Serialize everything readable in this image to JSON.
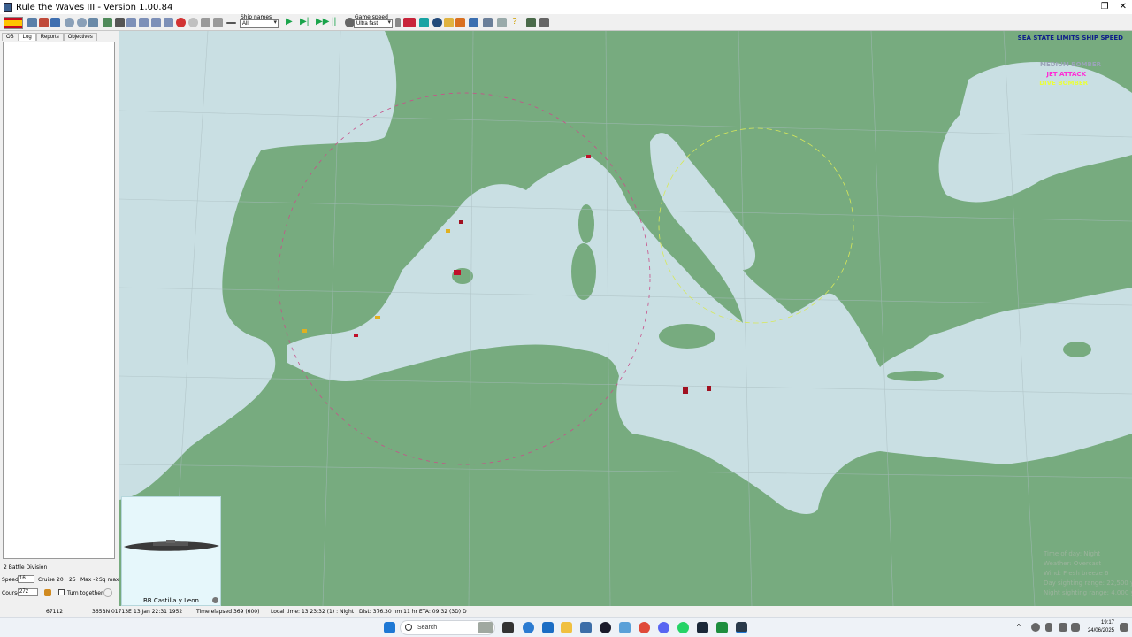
{
  "window": {
    "title": "Rule the Waves III - Version 1.00.84",
    "minimize": "─",
    "close": "✕",
    "restore": "❐"
  },
  "toolbar": {
    "ship_names_label": "Ship names",
    "ship_names_value": "All",
    "game_speed_label": "Game speed",
    "game_speed_value": "Ultra fast",
    "flag_country": "Spain"
  },
  "left_panel": {
    "tabs": [
      "OB",
      "Log",
      "Reports",
      "Objectives"
    ],
    "division_name": "2 Battle Division",
    "speed_label": "Speed",
    "speed_value": "16",
    "cruise_label": "Cruise",
    "cruise_values": [
      "20",
      "25"
    ],
    "max_label": "Max -2",
    "sq_label": "Sq max",
    "course_label": "Course",
    "course_value": "272",
    "turn_together_label": "Turn together"
  },
  "ship_card": {
    "name": "BB Castilla y Leon"
  },
  "map": {
    "sea_state_notice": "SEA STATE LIMITS SHIP SPEED",
    "legend": [
      {
        "label": "MEDIUM BOMBER",
        "color": "#9aa3b8"
      },
      {
        "label": "JET ATTACK",
        "color": "#ff2bd6"
      },
      {
        "label": "DIVE BOMBER",
        "color": "#eaff3a"
      }
    ],
    "weather": {
      "time_of_day": "Time of day: Night",
      "weather": "Weather: Overcast",
      "wind": "Wind: Fresh breeze  6",
      "day_sighting": "Day sighting range: 22,500 yds",
      "night_sighting": "Night sighting range: 4,000 yds"
    },
    "colors": {
      "sea": "#c9dfe3",
      "land": "#77ab7f"
    }
  },
  "status_bar": {
    "turn": "67112",
    "position": "365BN 01713E",
    "date": "13 Jan 22:31 1952",
    "elapsed": "Time elapsed 369 (600)",
    "local_time": "Local time: 13 23:32 (1) : Night",
    "distance": "Dist: 376.30 nm 11 hr ETA: 09:32 (3D) D"
  },
  "taskbar": {
    "search_placeholder": "Search",
    "clock_time": "19:17",
    "clock_date": "24/06/2025"
  }
}
